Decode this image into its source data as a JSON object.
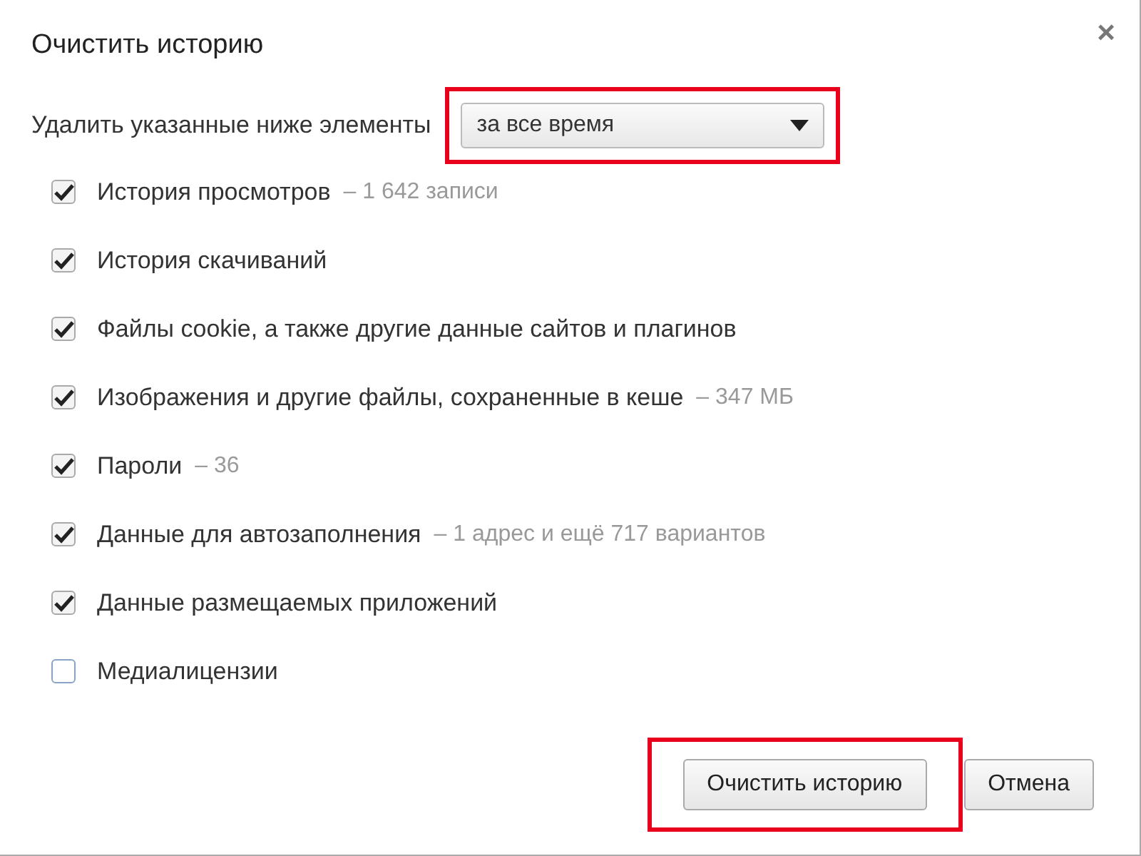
{
  "dialog": {
    "title": "Очистить историю",
    "close": "×"
  },
  "range": {
    "label": "Удалить указанные ниже элементы",
    "value": "за все время",
    "highlighted": true
  },
  "items": [
    {
      "label": "История просмотров",
      "detail": "– 1 642 записи",
      "checked": true
    },
    {
      "label": "История скачиваний",
      "checked": true
    },
    {
      "label": "Файлы cookie, а также другие данные сайтов и плагинов",
      "checked": true
    },
    {
      "label": "Изображения и другие файлы, сохраненные в кеше",
      "detail": "– 347 МБ",
      "checked": true
    },
    {
      "label": "Пароли",
      "detail": "– 36",
      "checked": true
    },
    {
      "label": "Данные для автозаполнения",
      "detail": "– 1 адрес и ещё 717 вариантов",
      "checked": true
    },
    {
      "label": "Данные размещаемых приложений",
      "checked": true
    },
    {
      "label": "Медиалицензии",
      "checked": false
    }
  ],
  "buttons": [
    {
      "label": "Очистить историю",
      "highlighted": true
    },
    {
      "label": "Отмена",
      "highlighted": false
    }
  ]
}
